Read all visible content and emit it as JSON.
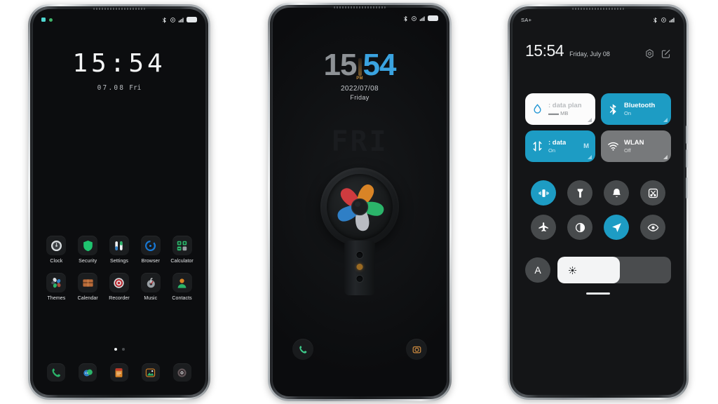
{
  "meta": {
    "scene": "three-android-phones-miui-theme",
    "background": "#ffffff",
    "accent": "#1d9cc4"
  },
  "phone1": {
    "label": "home-screen",
    "status_bar": {
      "notifications": [
        "notification-icon-teal",
        "notification-icon-green"
      ],
      "right_icons": [
        "bluetooth-icon",
        "alarm-icon",
        "signal-bars-icon",
        "battery-icon"
      ]
    },
    "clock": {
      "time": "15:54",
      "date": "07.08",
      "weekday": "Fri"
    },
    "apps": [
      {
        "label": "Clock",
        "icon": "clock-icon"
      },
      {
        "label": "Security",
        "icon": "shield-icon"
      },
      {
        "label": "Settings",
        "icon": "settings-sliders-icon"
      },
      {
        "label": "Browser",
        "icon": "browser-icon"
      },
      {
        "label": "Calculator",
        "icon": "calculator-icon"
      },
      {
        "label": "Themes",
        "icon": "themes-icon"
      },
      {
        "label": "Calendar",
        "icon": "calendar-icon"
      },
      {
        "label": "Recorder",
        "icon": "recorder-icon"
      },
      {
        "label": "Music",
        "icon": "music-icon"
      },
      {
        "label": "Contacts",
        "icon": "contacts-icon"
      }
    ],
    "page_indicator": {
      "total": 2,
      "current": 1
    },
    "dock": [
      {
        "label": "Phone",
        "icon": "phone-icon"
      },
      {
        "label": "Messages",
        "icon": "messages-icon"
      },
      {
        "label": "Notes",
        "icon": "notes-icon"
      },
      {
        "label": "Gallery",
        "icon": "gallery-icon"
      },
      {
        "label": "Camera",
        "icon": "camera-icon"
      }
    ]
  },
  "phone2": {
    "label": "lock-screen",
    "status_bar": {
      "right_icons": [
        "bluetooth-icon",
        "alarm-icon",
        "signal-bars-icon",
        "battery-icon"
      ]
    },
    "clock": {
      "hours": "15",
      "minutes": "54",
      "meridiem": "PM",
      "date": "2022/07/08",
      "weekday": "Friday"
    },
    "watermark_day": "FRI",
    "wallpaper": {
      "subject": "pinwheel-fan",
      "blades": [
        "#cf3b3f",
        "#d98426",
        "#2bb46a",
        "#b9bcc2",
        "#2f7fc6"
      ],
      "hub": "#1c1e20"
    },
    "shortcuts": [
      {
        "name": "phone-shortcut",
        "icon": "phone-icon",
        "color": "#3ec98a"
      },
      {
        "name": "camera-shortcut",
        "icon": "camera-icon",
        "color": "#c9883f"
      }
    ]
  },
  "phone3": {
    "label": "control-center",
    "status_bar": {
      "carrier": "SA+",
      "right_icons": [
        "bluetooth-icon",
        "alarm-icon",
        "signal-bars-icon"
      ]
    },
    "header": {
      "time": "15:54",
      "date": "Friday, July 08",
      "actions": [
        {
          "name": "settings-gear-button",
          "icon": "gear-icon"
        },
        {
          "name": "edit-button",
          "icon": "edit-pencil-icon"
        }
      ]
    },
    "big_tiles": [
      {
        "name": "data-plan-tile",
        "icon": "data-drop-icon",
        "title": ": data plan",
        "subtitle": "▬▬ MB",
        "state": "light"
      },
      {
        "name": "bluetooth-tile",
        "icon": "bluetooth-icon",
        "title": "Bluetooth",
        "subtitle": "On",
        "state": "accent"
      },
      {
        "name": "mobile-data-tile",
        "icon": "data-arrows-icon",
        "title": ": data",
        "subtitle": "On",
        "state": "accent",
        "trailing": "M"
      },
      {
        "name": "wlan-tile",
        "icon": "wifi-icon",
        "title": "WLAN",
        "subtitle": "Off",
        "state": "grey"
      }
    ],
    "toggles": [
      {
        "name": "vibrate-toggle",
        "icon": "vibrate-icon",
        "on": true
      },
      {
        "name": "flashlight-toggle",
        "icon": "flashlight-icon",
        "on": false
      },
      {
        "name": "ring-toggle",
        "icon": "bell-icon",
        "on": false
      },
      {
        "name": "screenshot-toggle",
        "icon": "scissors-screenshot-icon",
        "on": false
      },
      {
        "name": "airplane-toggle",
        "icon": "airplane-icon",
        "on": false
      },
      {
        "name": "dark-mode-toggle",
        "icon": "contrast-circle-icon",
        "on": false
      },
      {
        "name": "location-toggle",
        "icon": "location-arrow-icon",
        "on": true
      },
      {
        "name": "eye-comfort-toggle",
        "icon": "eye-icon",
        "on": false
      }
    ],
    "brightness": {
      "auto_label": "A",
      "icon": "sun-brightness-icon",
      "level_percent": 55
    }
  }
}
